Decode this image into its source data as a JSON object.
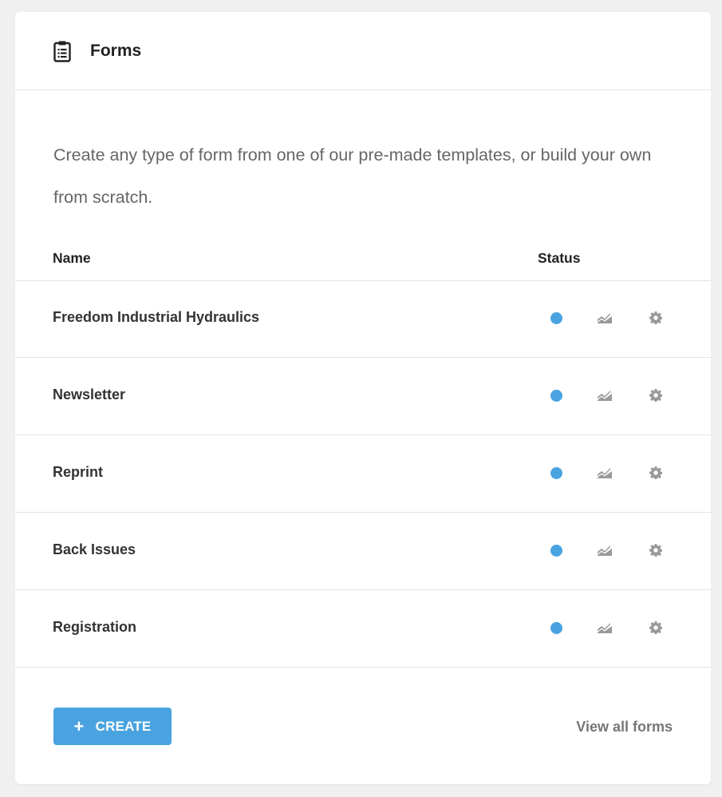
{
  "widget": {
    "title": "Forms",
    "description": "Create any type of form from one of our pre-made templates, or build your own from scratch."
  },
  "table": {
    "columns": {
      "name": "Name",
      "status": "Status"
    },
    "rows": [
      {
        "name": "Freedom Industrial Hydraulics",
        "status": "active"
      },
      {
        "name": "Newsletter",
        "status": "active"
      },
      {
        "name": "Reprint",
        "status": "active"
      },
      {
        "name": "Back Issues",
        "status": "active"
      },
      {
        "name": "Registration",
        "status": "active"
      }
    ]
  },
  "footer": {
    "create_label": "CREATE",
    "create_icon": "+",
    "view_all_label": "View all forms"
  },
  "colors": {
    "accent": "#4aa3e0",
    "status_active": "#4aa3e0",
    "icon_gray": "#9a9a9a"
  },
  "icons": {
    "header": "clipboard-icon",
    "stats": "stats-chart-icon",
    "settings": "gear-icon"
  }
}
